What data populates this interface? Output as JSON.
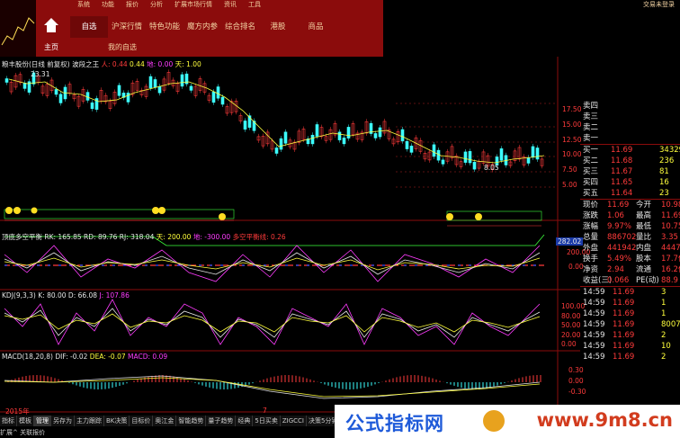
{
  "topmenu": {
    "items": [
      "系统",
      "功能",
      "报价",
      "分析",
      "扩展市场行情",
      "资讯",
      "工具"
    ],
    "right_link": "交易未登录",
    "home_label": "主页",
    "tabs": [
      "自选",
      "沪深行情",
      "特色功能",
      "魔方内参",
      "综合排名",
      "港股",
      "商品"
    ],
    "sub_label": "我的自选"
  },
  "chart": {
    "title": "粮丰股份(日线 前复权) 波段之王",
    "sig_a": "人: 0.44",
    "sig_b": "0.44",
    "sig_c": "地: 0.00",
    "sig_d": "天: 1.00",
    "high_label": "23.31",
    "low_label": "8.05",
    "price_ticks": [
      "17.50",
      "15.00",
      "12.50",
      "10.00",
      "7.50",
      "5.00"
    ],
    "panel2_title": "顶底多空平衡",
    "panel2_values": "RK: 165.85  RD: 89.76  RJ: 318.04",
    "panel2_tian": "天: 200.00",
    "panel2_di": "地: -300.00",
    "panel2_balance": "多空平衡线: 0.26",
    "panel2_box": "282.02",
    "panel2_ticks": [
      "200.00",
      "0.00"
    ],
    "kdj_title": "KDJ(9,3,3)",
    "kdj_values": "K: 80.00  D: 66.08",
    "kdj_j": "J: 107.86",
    "kdj_ticks": [
      "100.00",
      "80.00",
      "50.00",
      "20.00",
      "0.00"
    ],
    "macd_title": "MACD(18,20,8)",
    "macd_dif": "DIF: -0.02",
    "macd_dea": "DEA: -0.07",
    "macd_macd": "MACD: 0.09",
    "macd_ticks": [
      "0.30",
      "0.00",
      "-0.30"
    ],
    "year_label": "2015年",
    "month_label": "7"
  },
  "quote": {
    "asks": [
      {
        "label": "卖四",
        "price": "",
        "vol": ""
      },
      {
        "label": "卖三",
        "price": "",
        "vol": ""
      },
      {
        "label": "卖二",
        "price": "",
        "vol": ""
      },
      {
        "label": "卖一",
        "price": "",
        "vol": ""
      }
    ],
    "bids": [
      {
        "label": "买一",
        "price": "11.69",
        "vol": "34329"
      },
      {
        "label": "买二",
        "price": "11.68",
        "vol": "236"
      },
      {
        "label": "买三",
        "price": "11.67",
        "vol": "81"
      },
      {
        "label": "买四",
        "price": "11.65",
        "vol": "16"
      },
      {
        "label": "买五",
        "price": "11.64",
        "vol": "23"
      }
    ],
    "stats": [
      {
        "l1": "现价",
        "v1": "11.69",
        "l2": "今开",
        "v2": "10.98"
      },
      {
        "l1": "涨跌",
        "v1": "1.06",
        "l2": "最高",
        "v2": "11.69"
      },
      {
        "l1": "涨幅",
        "v1": "9.97%",
        "l2": "最低",
        "v2": "10.75"
      },
      {
        "l1": "总量",
        "v1": "886702",
        "l2": "量比",
        "v2": "3.35"
      },
      {
        "l1": "外盘",
        "v1": "441942",
        "l2": "内盘",
        "v2": "44476"
      },
      {
        "l1": "换手",
        "v1": "5.49%",
        "l2": "股本",
        "v2": "17.7亿"
      },
      {
        "l1": "净资",
        "v1": "2.94",
        "l2": "流通",
        "v2": "16.2亿"
      },
      {
        "l1": "收益(三)",
        "v1": "0.066",
        "l2": "PE(动)",
        "v2": "88.9"
      }
    ],
    "ticks": [
      {
        "time": "14:59",
        "price": "11.69",
        "vol": "3"
      },
      {
        "time": "14:59",
        "price": "11.69",
        "vol": "1"
      },
      {
        "time": "14:59",
        "price": "11.69",
        "vol": "1"
      },
      {
        "time": "14:59",
        "price": "11.69",
        "vol": "8007"
      },
      {
        "time": "14:59",
        "price": "11.69",
        "vol": "2"
      },
      {
        "time": "14:59",
        "price": "11.69",
        "vol": "10"
      },
      {
        "time": "14:59",
        "price": "11.69",
        "vol": "2"
      }
    ],
    "tick_icons": "S A ⊕ ▲ ◆ ■"
  },
  "bottom": {
    "tabs": [
      "指标",
      "模板",
      "管理",
      "另存为",
      "主力跟踪",
      "BK决策",
      "目标价",
      "奥江金",
      "智能趋势",
      "量子趋势",
      "经典",
      "5日买卖",
      "ZIGCCI",
      "决策5分钟",
      "天机",
      "主"
    ],
    "bar": [
      "扩展^",
      "关联报价"
    ]
  },
  "watermark": {
    "left": "公式指标网",
    "right": "www.9m8.cn"
  },
  "colors": {
    "up": "#ff3b3b",
    "down": "#3cffff",
    "ma": "#ffff3c",
    "brand": "#8b0c0c"
  }
}
